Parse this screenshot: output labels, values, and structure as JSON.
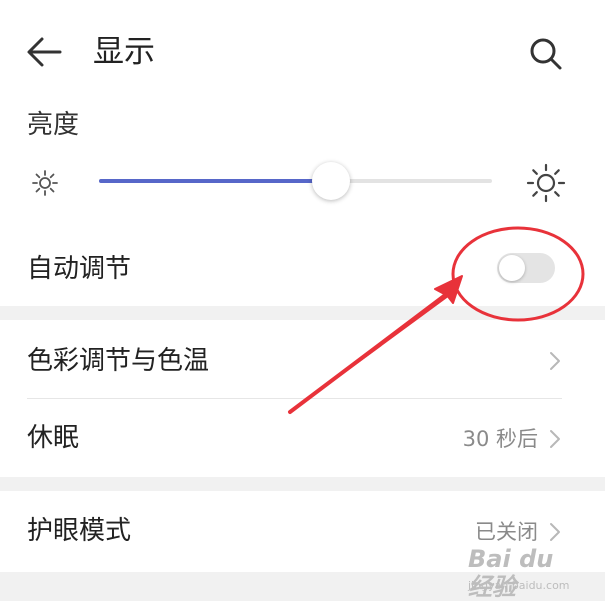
{
  "header": {
    "title": "显示",
    "back_icon": "back-arrow-icon",
    "search_icon": "search-icon"
  },
  "brightness": {
    "label": "亮度",
    "min_icon": "sun-small-icon",
    "max_icon": "sun-large-icon",
    "level": 0.59
  },
  "auto_adjust": {
    "label": "自动调节",
    "enabled": false
  },
  "rows": [
    {
      "label": "色彩调节与色温",
      "value": ""
    },
    {
      "label": "休眠",
      "value": "30 秒后"
    },
    {
      "label": "护眼模式",
      "value": "已关闭"
    }
  ],
  "colors": {
    "accent": "#5767c9",
    "annotation_red": "#e8323a"
  },
  "watermark": {
    "logo": "Bai du 经验",
    "url": "jingyan.baidu.com"
  }
}
